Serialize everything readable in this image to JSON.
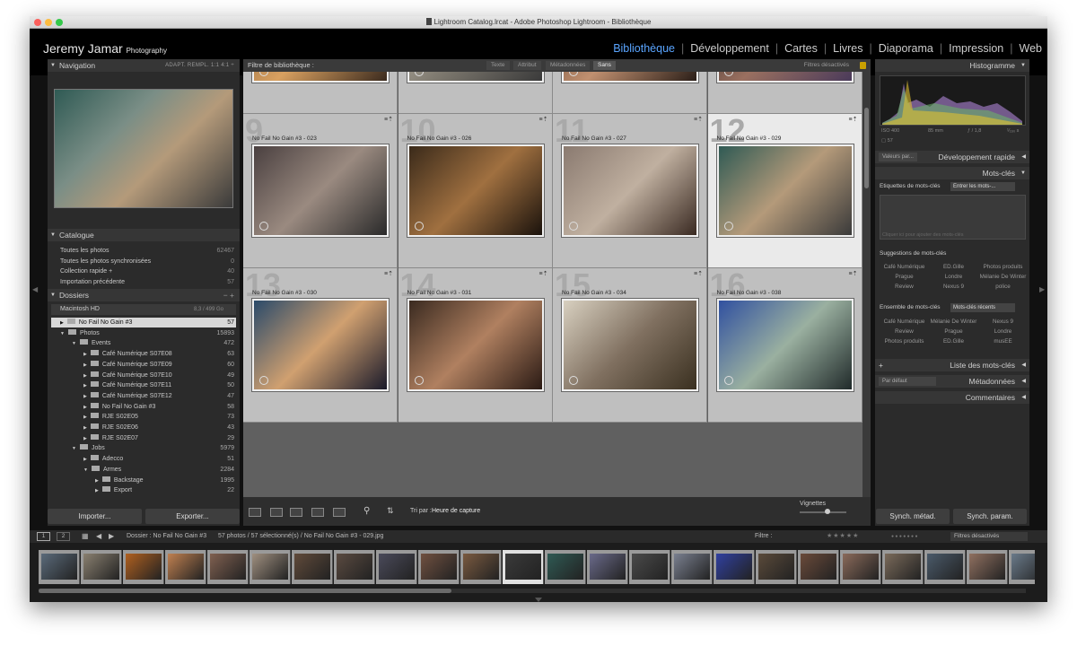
{
  "window": {
    "title": "Lightroom Catalog.lrcat - Adobe Photoshop Lightroom - Bibliothèque"
  },
  "identity": {
    "name": "Jeremy Jamar",
    "sub": "Photography"
  },
  "modules": [
    {
      "label": "Bibliothèque",
      "active": true
    },
    {
      "label": "Développement"
    },
    {
      "label": "Cartes"
    },
    {
      "label": "Livres"
    },
    {
      "label": "Diaporama"
    },
    {
      "label": "Impression"
    },
    {
      "label": "Web"
    }
  ],
  "left": {
    "navigation": {
      "title": "Navigation",
      "options": "ADAPT.   REMPL.   1:1   4:1  ÷"
    },
    "catalog": {
      "title": "Catalogue",
      "rows": [
        {
          "label": "Toutes les photos",
          "count": "62467"
        },
        {
          "label": "Toutes les photos synchronisées",
          "count": "0"
        },
        {
          "label": "Collection rapide +",
          "count": "40"
        },
        {
          "label": "Importation précédente",
          "count": "57"
        }
      ]
    },
    "folders": {
      "title": "Dossiers",
      "volume": "Macintosh HD",
      "volume_size": "8,3 / 499 Go",
      "items": [
        {
          "label": "No Fail No Gain #3",
          "count": "57",
          "indent": 0,
          "selected": true
        },
        {
          "label": "Photos",
          "count": "15893",
          "indent": 0
        },
        {
          "label": "Events",
          "count": "472",
          "indent": 1
        },
        {
          "label": "Café Numérique S07E08",
          "count": "63",
          "indent": 2
        },
        {
          "label": "Café Numérique S07E09",
          "count": "60",
          "indent": 2
        },
        {
          "label": "Café Numérique S07E10",
          "count": "49",
          "indent": 2
        },
        {
          "label": "Café Numérique S07E11",
          "count": "50",
          "indent": 2
        },
        {
          "label": "Café Numérique S07E12",
          "count": "47",
          "indent": 2
        },
        {
          "label": "No Fail No Gain #3",
          "count": "58",
          "indent": 2
        },
        {
          "label": "RJE S02E05",
          "count": "73",
          "indent": 2
        },
        {
          "label": "RJE S02E06",
          "count": "43",
          "indent": 2
        },
        {
          "label": "RJE S02E07",
          "count": "29",
          "indent": 2
        },
        {
          "label": "Jobs",
          "count": "5979",
          "indent": 1
        },
        {
          "label": "Adecco",
          "count": "51",
          "indent": 2
        },
        {
          "label": "Armes",
          "count": "2284",
          "indent": 2
        },
        {
          "label": "Backstage",
          "count": "1995",
          "indent": 3
        },
        {
          "label": "Export",
          "count": "22",
          "indent": 3
        }
      ]
    },
    "import_label": "Importer...",
    "export_label": "Exporter..."
  },
  "filter": {
    "title": "Filtre de bibliothèque :",
    "tabs": [
      "Texte",
      "Attribut",
      "Métadonnées",
      "Sans"
    ],
    "status": "Filtres désactivés"
  },
  "grid": {
    "cells": [
      {
        "num": "",
        "title": "",
        "colors": [
          "#7a5a3a",
          "#d8a060",
          "#3a2a1e"
        ]
      },
      {
        "num": "",
        "title": "",
        "colors": [
          "#c8c0b0",
          "#7f7a70",
          "#3a3a3a"
        ]
      },
      {
        "num": "",
        "title": "",
        "colors": [
          "#5a3a28",
          "#c09070",
          "#2a1e18"
        ]
      },
      {
        "num": "",
        "title": "",
        "colors": [
          "#2a2320",
          "#9a7060",
          "#4a3a5a"
        ]
      },
      {
        "num": "9",
        "title": "No Fail No Gain #3 - 023",
        "colors": [
          "#4a4040",
          "#9a8a80",
          "#2a2a2a"
        ]
      },
      {
        "num": "10",
        "title": "No Fail No Gain #3 - 026",
        "colors": [
          "#3a2a1a",
          "#a07040",
          "#1a120c"
        ]
      },
      {
        "num": "11",
        "title": "No Fail No Gain #3 - 027",
        "colors": [
          "#8a7a70",
          "#c0b0a0",
          "#3a2a22"
        ]
      },
      {
        "num": "12",
        "title": "No Fail No Gain #3 - 029",
        "colors": [
          "#2f5a54",
          "#b49a7a",
          "#3a3a3a"
        ],
        "selected": true
      },
      {
        "num": "13",
        "title": "No Fail No Gain #3 - 030",
        "colors": [
          "#2a4a6a",
          "#d0a070",
          "#1a1a2a"
        ]
      },
      {
        "num": "14",
        "title": "No Fail No Gain #3 - 031",
        "colors": [
          "#3a2a20",
          "#b08060",
          "#2a1a14"
        ]
      },
      {
        "num": "15",
        "title": "No Fail No Gain #3 - 034",
        "colors": [
          "#d8d0c0",
          "#807060",
          "#3a3020"
        ]
      },
      {
        "num": "16",
        "title": "No Fail No Gain #3 - 038",
        "colors": [
          "#3050a0",
          "#9ab0a0",
          "#202a2a"
        ]
      }
    ]
  },
  "toolbar": {
    "sort_label": "Tri par :",
    "sort_value": "Heure de capture",
    "vignettes": "Vignettes"
  },
  "right": {
    "histogram": {
      "title": "Histogramme",
      "iso": "ISO 400",
      "focal": "85 mm",
      "aperture": "ƒ / 1,8",
      "shutter": "¹⁄₁₆₀ s",
      "count": "57"
    },
    "quick_dev": {
      "title": "Développement rapide",
      "preset": "Valeurs par..."
    },
    "keywords": {
      "title": "Mots-clés",
      "tags_label": "Etiquettes de mots-clés",
      "tags_mode": "Entrer les mots-...",
      "placeholder": "Cliquer ici pour ajouter des mots-clés",
      "suggest_title": "Suggestions de mots-clés",
      "suggestions": [
        "Café Numérique",
        "ED.Gille",
        "Photos produits",
        "Prague",
        "Londre",
        "Mélanie De Winter",
        "Review",
        "Nexus 9",
        "police"
      ],
      "set_title": "Ensemble de mots-clés",
      "set_value": "Mots-clés récents",
      "set_items": [
        "Café Numérique",
        "Mélanie De Winter",
        "Nexus 9",
        "Review",
        "Prague",
        "Londre",
        "Photos produits",
        "ED.Gille",
        "musEE"
      ]
    },
    "keyword_list": "Liste des mots-clés",
    "metadata": {
      "title": "Métadonnées",
      "preset": "Par défaut"
    },
    "comments": "Commentaires",
    "sync_meta": "Synch. métad.",
    "sync_params": "Synch. param."
  },
  "filmstrip": {
    "pages": [
      "1",
      "2"
    ],
    "folder": "Dossier : No Fail No Gain #3",
    "info": "57 photos / 57 sélectionné(s) / No Fail No Gain #3 - 029.jpg",
    "filter_label": "Filtre :",
    "filter_status": "Filtres désactivés",
    "thumbs": [
      "#5a6a7a",
      "#8a8070",
      "#b06020",
      "#c08050",
      "#806050",
      "#a09080",
      "#604a3a",
      "#5a4a40",
      "#4a4a5a",
      "#705040",
      "#7a5a40",
      "#3a3a3a",
      "#2f5a54",
      "#6a6a8a",
      "#4a4a4a",
      "#7a8090",
      "#3040a0",
      "#5a4a3a",
      "#6a4a3a",
      "#8a6a5a",
      "#7a6a5a",
      "#4a5a6a",
      "#907060",
      "#6a7a8a",
      "#806a5a"
    ]
  }
}
